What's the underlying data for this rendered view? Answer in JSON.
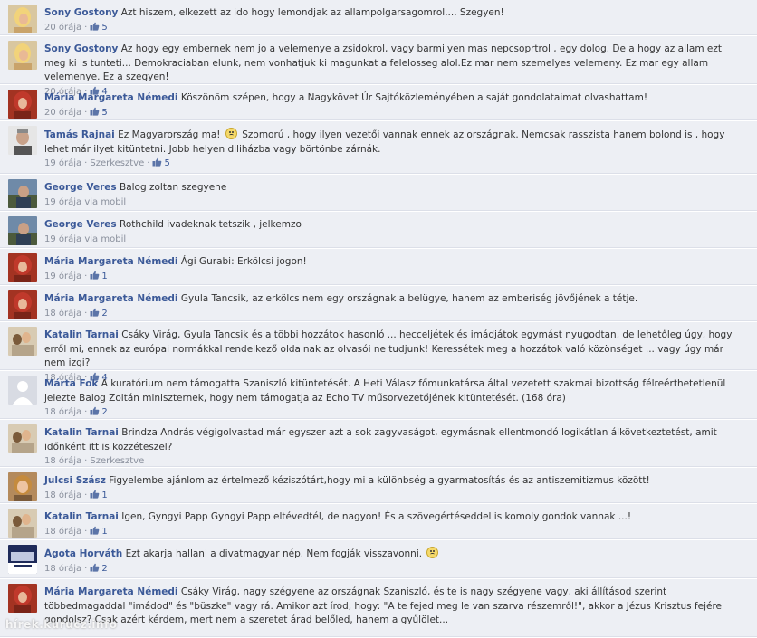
{
  "comments": [
    {
      "author": "Sony Gostony",
      "text": "Azt hiszem, elkezett az ido hogy lemondjak az allampolgarsagomrol.... Szegyen!",
      "time": "20 órája",
      "edited": "",
      "likes": "5",
      "via": "",
      "avatar": "sony"
    },
    {
      "author": "Sony Gostony",
      "text": "Az hogy egy embernek nem jo a velemenye a zsidokrol, vagy barmilyen mas nepcsoprtrol , egy dolog. De a hogy az allam ezt meg ki is tunteti... Demokraciaban elunk, nem vonhatjuk ki magunkat a felelosseg alol.Ez mar nem szemelyes velemeny. Ez mar egy allam velemenye. Ez a szegyen!",
      "time": "20 órája",
      "edited": "",
      "likes": "4",
      "via": "",
      "avatar": "sony"
    },
    {
      "author": "Mária Margareta Némedi",
      "text": "Köszönöm szépen, hogy a Nagykövet Úr Sajtóközleményében a saját gondolataimat olvashattam!",
      "time": "20 órája",
      "edited": "",
      "likes": "5",
      "via": "",
      "avatar": "maria"
    },
    {
      "author": "Tamás Rajnai",
      "text_before": "Ez Magyarország ma!",
      "text_after": "Szomorú , hogy ilyen vezetői vannak ennek az országnak. Nemcsak rasszista hanem bolond is , hogy lehet már ilyet kitüntetni. Jobb helyen diliházba vagy börtönbe zárnák.",
      "time": "19 órája",
      "edited": "Szerkesztve",
      "likes": "5",
      "via": "",
      "avatar": "tamas",
      "emoticon": true
    },
    {
      "author": "George Veres",
      "text": "Balog zoltan szegyene",
      "time": "19 órája",
      "edited": "",
      "likes": "",
      "via": "via mobil",
      "avatar": "george"
    },
    {
      "author": "George Veres",
      "text": "Rothchild ivadeknak tetszik , jelkemzo",
      "time": "19 órája",
      "edited": "",
      "likes": "",
      "via": "via mobil",
      "avatar": "george"
    },
    {
      "author": "Mária Margareta Némedi",
      "text": "Ági Gurabi: Erkölcsi jogon!",
      "time": "19 órája",
      "edited": "",
      "likes": "1",
      "via": "",
      "avatar": "maria"
    },
    {
      "author": "Mária Margareta Némedi",
      "text": "Gyula Tancsik, az erkölcs nem egy országnak a belügye, hanem az emberiség jövőjének a tétje.",
      "time": "18 órája",
      "edited": "",
      "likes": "2",
      "via": "",
      "avatar": "maria"
    },
    {
      "author": "Katalin Tarnai",
      "text": "Csáky Virág, Gyula Tancsik és a többi hozzátok hasonló ... hecceljétek és imádjátok egymást nyugodtan, de lehetőleg úgy, hogy erről mi, ennek az európai normákkal rendelkező oldalnak az olvasói ne tudjunk! Keressétek meg a hozzátok való közönséget ... vagy úgy már nem izgi?",
      "time": "18 órája",
      "edited": "",
      "likes": "4",
      "via": "",
      "avatar": "katalin"
    },
    {
      "author": "Márta Fok",
      "text": "A kuratórium nem támogatta Szaniszló kitüntetését. A Heti Válasz főmunkatársa által vezetett szakmai bizottság félreérthetetlenül jelezte Balog Zoltán miniszternek, hogy nem támogatja az Echo TV műsorvezetőjének kitüntetését. (168 óra)",
      "time": "18 órája",
      "edited": "",
      "likes": "2",
      "via": "",
      "avatar": "marta"
    },
    {
      "author": "Katalin Tarnai",
      "text": "Brindza András végigolvastad már egyszer azt a sok zagyvaságot, egymásnak ellentmondó logikátlan álkövetkeztetést, amit időnként itt is közzéteszel?",
      "time": "18 órája",
      "edited": "Szerkesztve",
      "likes": "",
      "via": "",
      "avatar": "katalin"
    },
    {
      "author": "Julcsi Szász",
      "text": "Figyelembe ajánlom az értelmező kéziszótárt,hogy mi a különbség a gyarmatosítás és az antiszemitizmus között!",
      "time": "18 órája",
      "edited": "",
      "likes": "1",
      "via": "",
      "avatar": "julcsi"
    },
    {
      "author": "Katalin Tarnai",
      "text": "Igen, Gyngyi Papp Gyngyi Papp eltévedtél, de nagyon! És a szövegértéseddel is komoly gondok vannak ...!",
      "time": "18 órája",
      "edited": "",
      "likes": "1",
      "via": "",
      "avatar": "katalin"
    },
    {
      "author": "Ágota Horváth",
      "text_before": "Ezt akarja hallani a divatmagyar nép. Nem fogják visszavonni.",
      "text_after": "",
      "time": "18 órája",
      "edited": "",
      "likes": "2",
      "via": "",
      "avatar": "agota",
      "emoticon": true
    },
    {
      "author": "Mária Margareta Némedi",
      "text": "Csáky Virág, nagy szégyene az országnak Szaniszló, és te is nagy szégyene vagy, aki állításod szerint többedmagaddal \"imádod\" és \"büszke\" vagy rá. Amikor azt írod, hogy: \"A te fejed meg le van szarva részemről!\", akkor a Jézus Krisztus fejére gondolsz? Csak azért kérdem, mert nem a szeretet árad belőled, hanem a gyűlölet...",
      "time": "",
      "edited": "",
      "likes": "",
      "via": "",
      "avatar": "maria"
    }
  ],
  "watermark": "hírek.kurucz.info",
  "colors": {
    "link": "#3b5998",
    "meta": "#898f9c",
    "background": "#edeff4"
  }
}
